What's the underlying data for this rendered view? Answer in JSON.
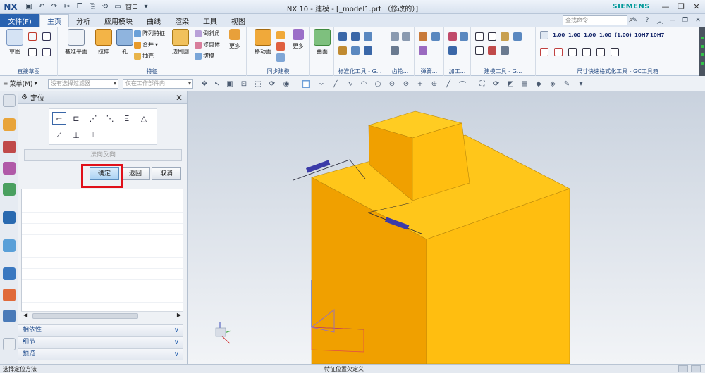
{
  "app": {
    "logo": "NX",
    "title": "NX 10 - 建模 - [_model1.prt （修改的）]",
    "brand": "SIEMENS",
    "window_menu": "窗口"
  },
  "ribbon_tabs": [
    "主页",
    "分析",
    "应用模块",
    "曲线",
    "渲染",
    "工具",
    "视图"
  ],
  "file_tab": "文件(F)",
  "active_tab": "主页",
  "command_search_placeholder": "查找命令",
  "ribbon": {
    "sketch_group": {
      "label": "直接草图",
      "sketch": "草图"
    },
    "feature_group": {
      "label": "特征",
      "datum_plane": "基准平面",
      "extrude": "拉伸",
      "hole": "孔",
      "pattern": "阵列特征",
      "unite": "合并",
      "shell": "抽壳",
      "edge_blend": "边倒圆",
      "chamfer": "倒斜角",
      "trim_body": "修剪体",
      "draft": "拔模",
      "more": "更多"
    },
    "sync_group": {
      "label": "同步建模",
      "move_face": "移动面",
      "more": "更多"
    },
    "surface_group": {
      "surface": "曲面"
    },
    "std_parts_group": {
      "label": "标准化工具 - G..."
    },
    "gear_group": {
      "label": "齿轮..."
    },
    "spring_group": {
      "label": "弹簧..."
    },
    "machining_group": {
      "label": "加工..."
    },
    "build_group": {
      "label": "建模工具 - G..."
    },
    "dim_group": {
      "label": "尺寸快速格式化工具 - GC工具箱",
      "dims": [
        "1.00",
        "1.00",
        "1.00",
        "1.00",
        "(1.00)",
        "10H7",
        "10H7"
      ]
    }
  },
  "selection_bar": {
    "menu": "菜单(M)",
    "filter_placeholder": "没有选择过滤器",
    "scope_placeholder": "仅在工作部件内"
  },
  "dialog": {
    "title": "定位",
    "reverse_label": "法向反向",
    "ok": "确定",
    "back": "返回",
    "cancel": "取消",
    "sections": [
      "相依性",
      "细节",
      "预览"
    ]
  },
  "status": {
    "left": "选择定位方法",
    "middle": "特征位置欠定义"
  },
  "colors": {
    "accent": "#2a63b0",
    "highlight_box": "#e0101a",
    "part_front": "#f0a000",
    "part_side": "#ffbe10",
    "part_top": "#ffc61a"
  }
}
